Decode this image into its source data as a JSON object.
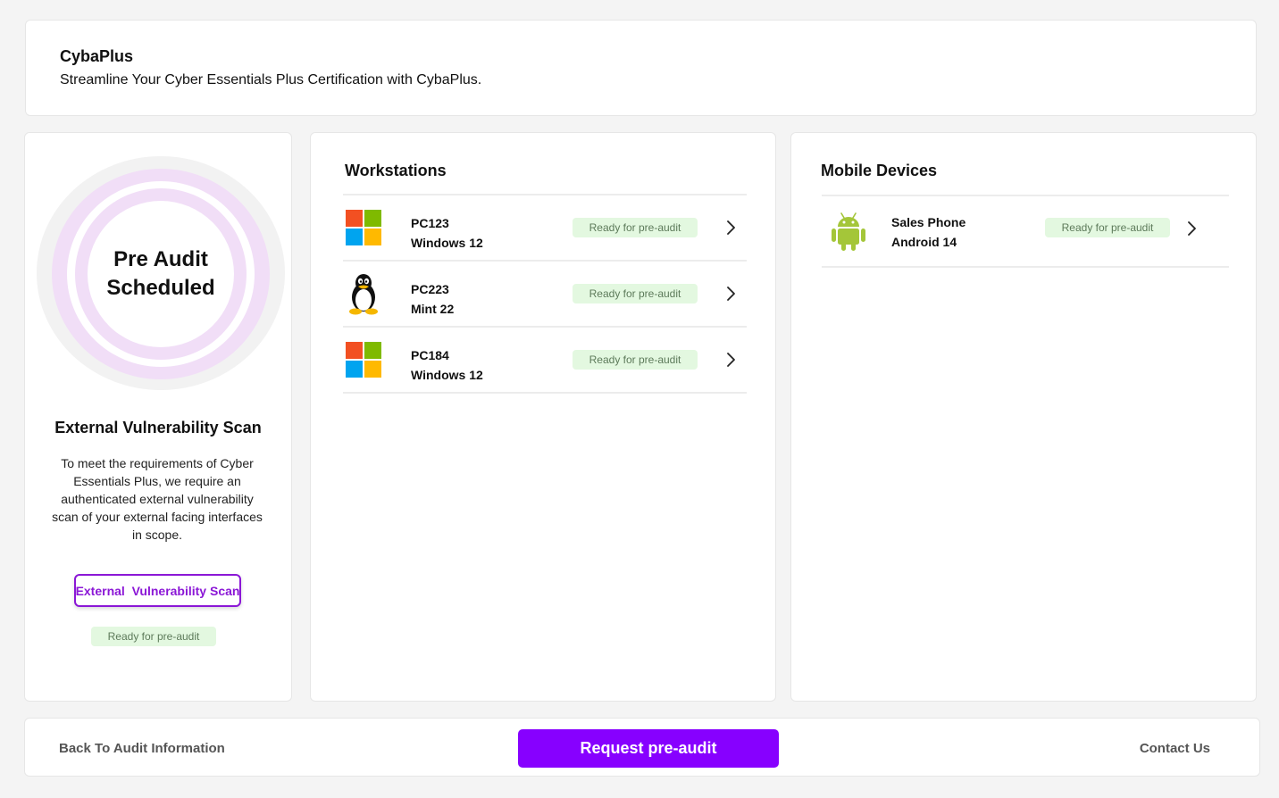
{
  "header": {
    "app_title": "CybaPlus",
    "tagline": "Streamline Your Cyber Essentials Plus Certification with CybaPlus."
  },
  "status_ring": {
    "label": "Pre Audit Scheduled",
    "accent_color": "#f1def7"
  },
  "external_scan": {
    "title": "External Vulnerability Scan",
    "description": "To meet the requirements of Cyber Essentials Plus, we require an authenticated external vulnerability scan of your external facing interfaces in scope.",
    "button_label": "External  Vulnerability Scan",
    "status": "Ready for pre-audit"
  },
  "workstations": {
    "title": "Workstations",
    "items": [
      {
        "name": "PC123",
        "os": "Windows 12",
        "icon": "windows-icon",
        "status": "Ready for pre-audit"
      },
      {
        "name": "PC223",
        "os": "Mint 22",
        "icon": "linux-tux-icon",
        "status": "Ready for pre-audit"
      },
      {
        "name": "PC184",
        "os": "Windows 12",
        "icon": "windows-icon",
        "status": "Ready for pre-audit"
      }
    ]
  },
  "mobile_devices": {
    "title": "Mobile Devices",
    "items": [
      {
        "name": "Sales Phone",
        "os": "Android 14",
        "icon": "android-icon",
        "status": "Ready for pre-audit"
      }
    ]
  },
  "footer": {
    "back_label": "Back To Audit Information",
    "request_label": "Request pre-audit",
    "contact_label": "Contact Us"
  },
  "colors": {
    "brand_purple": "#8700ff",
    "scan_button_border": "#8b17d6",
    "badge_bg": "#e3f8e0",
    "badge_text": "#5d7a5a"
  }
}
